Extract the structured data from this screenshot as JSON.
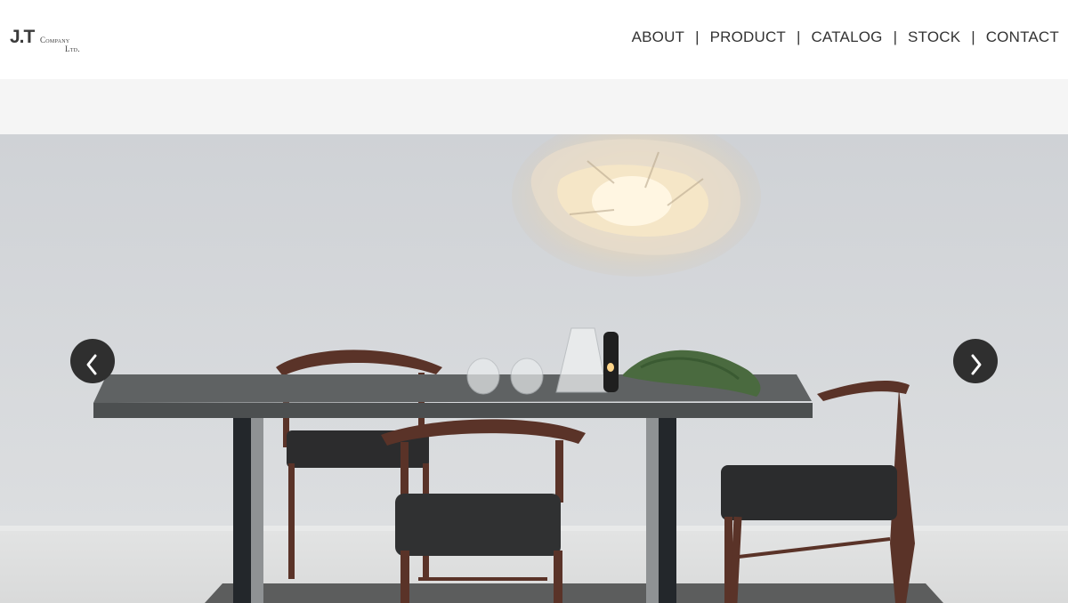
{
  "brand": {
    "logo_main": "J.T",
    "logo_company": "Company",
    "logo_ltd": "Ltd."
  },
  "nav": {
    "items": [
      {
        "label": "ABOUT"
      },
      {
        "label": "PRODUCT"
      },
      {
        "label": "CATALOG"
      },
      {
        "label": "STOCK"
      },
      {
        "label": "CONTACT"
      }
    ],
    "separator": "|"
  },
  "slider": {
    "prev_icon": "chevron-left-icon",
    "next_icon": "chevron-right-icon",
    "image": "dining-table-with-chairs-and-pendant-lamp"
  },
  "colors": {
    "header_bg": "#ffffff",
    "band_bg": "#f5f5f5",
    "arrow_bg": "#2f2f2f",
    "text": "#333333"
  }
}
